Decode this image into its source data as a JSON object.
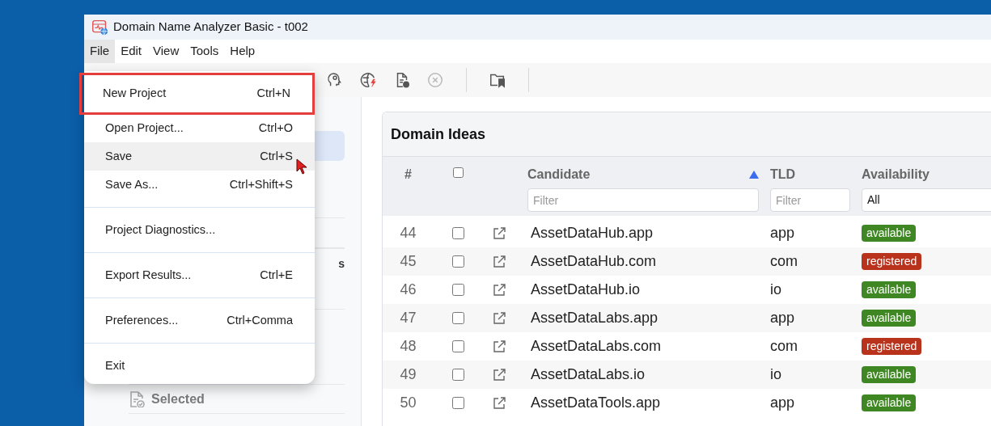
{
  "window": {
    "title": "Domain Name Analyzer Basic - t002"
  },
  "menubar": [
    {
      "label": "File",
      "selected": true
    },
    {
      "label": "Edit",
      "selected": false
    },
    {
      "label": "View",
      "selected": false
    },
    {
      "label": "Tools",
      "selected": false
    },
    {
      "label": "Help",
      "selected": false
    }
  ],
  "toolbar": [
    {
      "kind": "head-gear"
    },
    {
      "kind": "globe-bolt"
    },
    {
      "kind": "document"
    },
    {
      "kind": "cancel",
      "disabled": true
    },
    {
      "kind": "separator"
    },
    {
      "kind": "folder-bookmark"
    },
    {
      "kind": "separator"
    }
  ],
  "file_menu": [
    {
      "kind": "item",
      "label": "New Project",
      "shortcut": "Ctrl+N",
      "outlined": true,
      "hovered": false
    },
    {
      "kind": "item",
      "label": "Open Project...",
      "shortcut": "Ctrl+O",
      "outlined": false,
      "hovered": false
    },
    {
      "kind": "item",
      "label": "Save",
      "shortcut": "Ctrl+S",
      "outlined": false,
      "hovered": true
    },
    {
      "kind": "item",
      "label": "Save As...",
      "shortcut": "Ctrl+Shift+S",
      "outlined": false,
      "hovered": false
    },
    {
      "kind": "separator"
    },
    {
      "kind": "item",
      "label": "Project Diagnostics...",
      "outlined": false,
      "hovered": false
    },
    {
      "kind": "separator"
    },
    {
      "kind": "item",
      "label": "Export Results...",
      "shortcut": "Ctrl+E",
      "outlined": false,
      "hovered": false
    },
    {
      "kind": "separator"
    },
    {
      "kind": "item",
      "label": "Preferences...",
      "shortcut": "Ctrl+Comma",
      "outlined": false,
      "hovered": false
    },
    {
      "kind": "separator"
    },
    {
      "kind": "item",
      "label": "Exit",
      "outlined": false,
      "hovered": false
    }
  ],
  "sidebar": {
    "items": [
      {
        "selected": true
      },
      {
        "label": "s",
        "selected": false
      },
      {
        "label": "Selected",
        "selected": false
      }
    ]
  },
  "table": {
    "title": "Domain Ideas",
    "columns": [
      {
        "label": "#"
      },
      {
        "kind": "checkbox",
        "checked": false
      },
      {
        "kind": "blank"
      },
      {
        "label": "Candidate",
        "sorted": true,
        "filter_placeholder": "Filter"
      },
      {
        "label": "TLD",
        "filter_placeholder": "Filter"
      },
      {
        "label": "Availability",
        "filter_value": "All"
      }
    ],
    "rows": [
      {
        "num": "44",
        "checked": false,
        "candidate": "AssetDataHub.app",
        "tld": "app",
        "availability": "available",
        "color": "#3f8722"
      },
      {
        "num": "45",
        "checked": false,
        "candidate": "AssetDataHub.com",
        "tld": "com",
        "availability": "registered",
        "color": "#b9321c"
      },
      {
        "num": "46",
        "checked": false,
        "candidate": "AssetDataHub.io",
        "tld": "io",
        "availability": "available",
        "color": "#3f8722"
      },
      {
        "num": "47",
        "checked": false,
        "candidate": "AssetDataLabs.app",
        "tld": "app",
        "availability": "available",
        "color": "#3f8722"
      },
      {
        "num": "48",
        "checked": false,
        "candidate": "AssetDataLabs.com",
        "tld": "com",
        "availability": "registered",
        "color": "#b9321c"
      },
      {
        "num": "49",
        "checked": false,
        "candidate": "AssetDataLabs.io",
        "tld": "io",
        "availability": "available",
        "color": "#3f8722"
      },
      {
        "num": "50",
        "checked": false,
        "candidate": "AssetDataTools.app",
        "tld": "app",
        "availability": "available",
        "color": "#3f8722"
      }
    ]
  }
}
